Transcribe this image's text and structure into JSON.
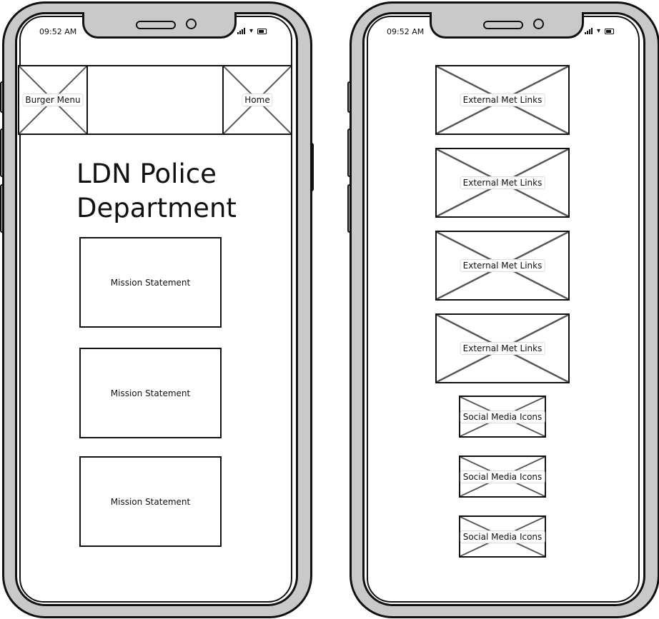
{
  "phones": [
    {
      "status_time": "09:52 AM",
      "header": {
        "left_placeholder_label": "Burger Menu",
        "right_placeholder_label": "Home"
      },
      "title_lines": [
        "LDN Police",
        "Department"
      ],
      "sections": [
        "Mission Statement",
        "Mission Statement",
        "Mission Statement"
      ]
    },
    {
      "status_time": "09:52 AM",
      "link_placeholders": [
        "External Met Links",
        "External Met Links",
        "External Met Links",
        "External Met Links"
      ],
      "social_placeholders": [
        "Social Media Icons",
        "Social Media Icons",
        "Social Media Icons"
      ]
    }
  ],
  "colors": {
    "frame": "#c9c9c9",
    "stroke": "#111111",
    "cross": "#555555"
  },
  "icons": [
    "signal-icon",
    "wifi-icon",
    "battery-icon"
  ]
}
